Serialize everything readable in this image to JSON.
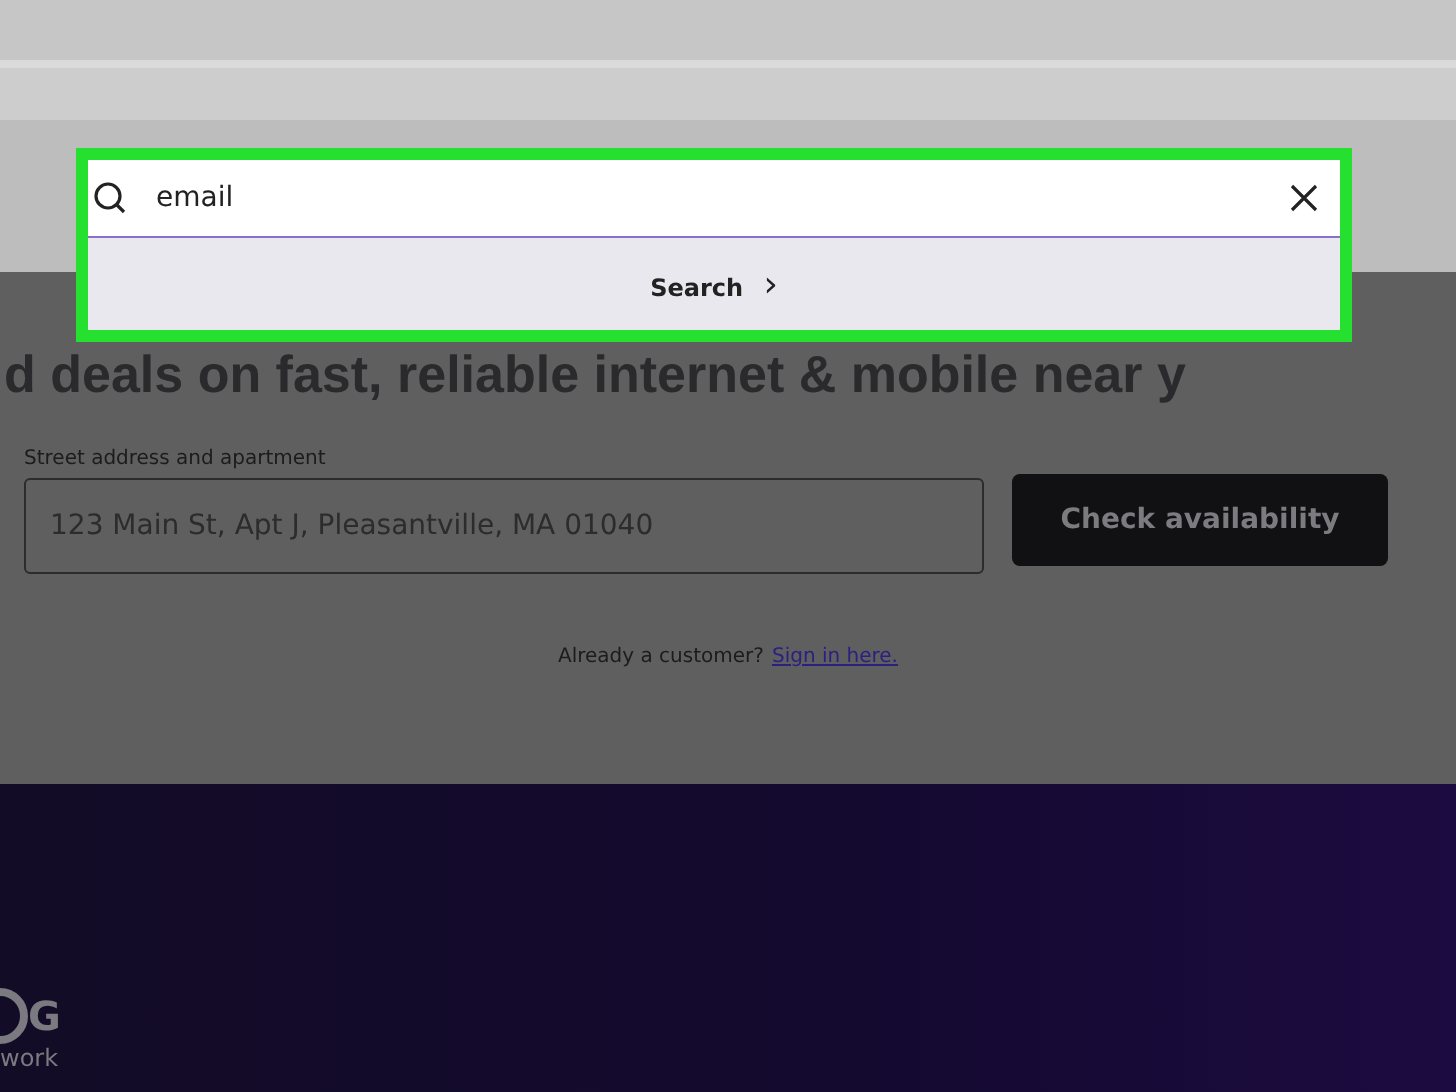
{
  "search_overlay": {
    "value": "email",
    "highlighted": true,
    "submit_label": "Search",
    "submit_icon": "›"
  },
  "hero": {
    "headline": "d deals on fast, reliable internet & mobile near y",
    "address_field": {
      "label": "Street address and apartment",
      "placeholder": "123 Main St, Apt J, Pleasantville, MA 01040"
    },
    "check_button": "Check availability",
    "customer_prompt": {
      "text": "Already a customer?",
      "link": "Sign in here."
    }
  },
  "footer_banner": {
    "logo_text": "G",
    "logo_subtext": "work"
  }
}
